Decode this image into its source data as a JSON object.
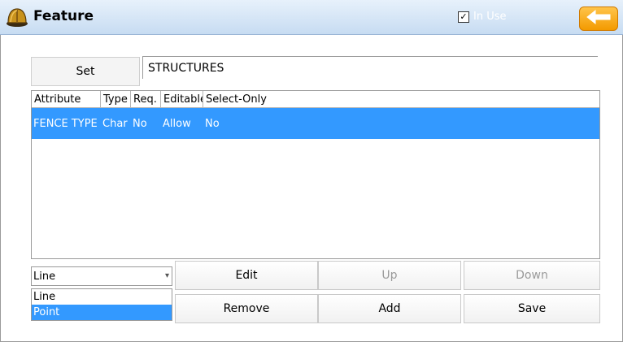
{
  "window": {
    "title": "Feature",
    "in_use_label": "In Use",
    "in_use_checked": true
  },
  "set": {
    "button_label": "Set",
    "value": "STRUCTURES"
  },
  "table": {
    "columns": [
      "Attribute",
      "Type",
      "Req.",
      "Editable",
      "Select-Only"
    ],
    "rows": [
      {
        "attribute": "FENCE TYPE",
        "type": "Char",
        "req": "No",
        "editable": "Allow",
        "select_only": "No"
      }
    ]
  },
  "geometry_select": {
    "value": "Line",
    "options": [
      "Line",
      "Point"
    ],
    "highlighted": "Point"
  },
  "buttons": {
    "edit": "Edit",
    "up": "Up",
    "down": "Down",
    "remove": "Remove",
    "add": "Add",
    "save": "Save"
  },
  "colors": {
    "selection": "#3399ff",
    "back_button": "#f5a300",
    "titlebar": "#d6e6f7"
  }
}
